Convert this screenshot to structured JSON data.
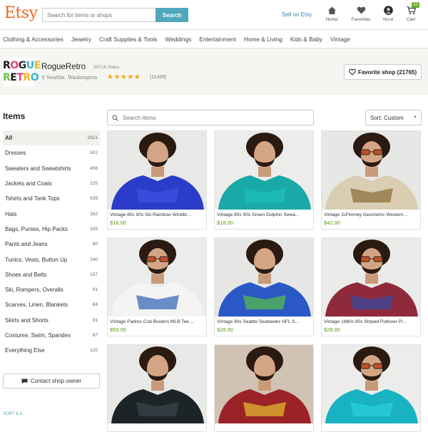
{
  "header": {
    "logo": "Etsy",
    "search_placeholder": "Search for items or shops",
    "search_button": "Search",
    "sell": "Sell on Etsy",
    "nav": [
      {
        "label": "Home",
        "icon": "home-icon"
      },
      {
        "label": "Favorites",
        "icon": "heart-icon"
      },
      {
        "label": "You",
        "icon": "avatar-icon"
      },
      {
        "label": "Cart",
        "icon": "cart-icon",
        "badge": "10"
      }
    ]
  },
  "categories": [
    "Clothing & Accessories",
    "Jewelry",
    "Craft Supplies & Tools",
    "Weddings",
    "Entertainment",
    "Home & Living",
    "Kids & Baby",
    "Vintage"
  ],
  "shop": {
    "logo_row1": [
      "R",
      "O",
      "G",
      "U",
      "E"
    ],
    "logo_row2": [
      "R",
      "E",
      "T",
      "R",
      "O"
    ],
    "name": "RogueRetro",
    "sales": "30716 Sales",
    "location": "Seattle, Washington",
    "stars": "★★★★★",
    "reviews": "(11439)",
    "favorite_button": "Favorite shop (21765)"
  },
  "sidebar": {
    "heading": "Items",
    "items": [
      {
        "label": "All",
        "count": "2921"
      },
      {
        "label": "Dresses",
        "count": "502"
      },
      {
        "label": "Sweaters and Sweatshirts",
        "count": "456"
      },
      {
        "label": "Jackets and Coats",
        "count": "225"
      },
      {
        "label": "Tshirts and Tank Tops",
        "count": "539"
      },
      {
        "label": "Hats",
        "count": "162"
      },
      {
        "label": "Bags, Purses, Hip Packs",
        "count": "105"
      },
      {
        "label": "Pants and Jeans",
        "count": "90"
      },
      {
        "label": "Tunics, Vests, Button Up",
        "count": "240"
      },
      {
        "label": "Shoes and Belts",
        "count": "157"
      },
      {
        "label": "Ski, Rompers, Overalls",
        "count": "91"
      },
      {
        "label": "Scarves, Linen, Blankets",
        "count": "84"
      },
      {
        "label": "Skirts and Shorts",
        "count": "81"
      },
      {
        "label": "Costume, Swim, Spandex",
        "count": "67"
      },
      {
        "label": "Everything Else",
        "count": "120"
      }
    ],
    "contact": "Contact shop owner",
    "bottom": "SORT & A"
  },
  "main": {
    "search_placeholder": "Search items",
    "sort": "Sort: Custom"
  },
  "listings": [
    {
      "title": "Vintage 80s 90s Ski Rainbow Windbr...",
      "price": "$18.00",
      "shirt": "#2b3cc9",
      "accent": "#4050e6",
      "bg": "#e8e8e6",
      "glasses": false
    },
    {
      "title": "Vintage 80s 90s Green Dolphin Swea...",
      "price": "$18.00",
      "shirt": "#19a9a6",
      "accent": "#20c2bc",
      "bg": "#ececea",
      "glasses": false
    },
    {
      "title": "Vintage JcPenney Geometric Western...",
      "price": "$42.00",
      "shirt": "#d9cdb2",
      "accent": "#8a6a35",
      "bg": "#e7e7e5",
      "glasses": true
    },
    {
      "title": "Vintage Padres Cub Busters MLB Tee ...",
      "price": "$50.00",
      "shirt": "#f4f4f2",
      "accent": "#2f5fb5",
      "bg": "#ececec",
      "glasses": true
    },
    {
      "title": "Vintage 90s Seattle Seahawks NFL S...",
      "price": "$28.00",
      "shirt": "#2a59c6",
      "accent": "#58c043",
      "bg": "#e6e6e4",
      "glasses": false
    },
    {
      "title": "Vintage 1980s 90s Striped Pullover Pi...",
      "price": "$28.00",
      "shirt": "#8f2a3d",
      "accent": "#3148a1",
      "bg": "#ebebe9",
      "glasses": true
    },
    {
      "title": "",
      "price": "",
      "shirt": "#1d2428",
      "accent": "#3a454a",
      "bg": "#e8e8e6",
      "glasses": false
    },
    {
      "title": "",
      "price": "",
      "shirt": "#9b2328",
      "accent": "#e6c12c",
      "bg": "#d0c3b4",
      "glasses": false
    },
    {
      "title": "",
      "price": "",
      "shirt": "#18b2c3",
      "accent": "#2bd1d9",
      "bg": "#ececea",
      "glasses": true
    }
  ]
}
